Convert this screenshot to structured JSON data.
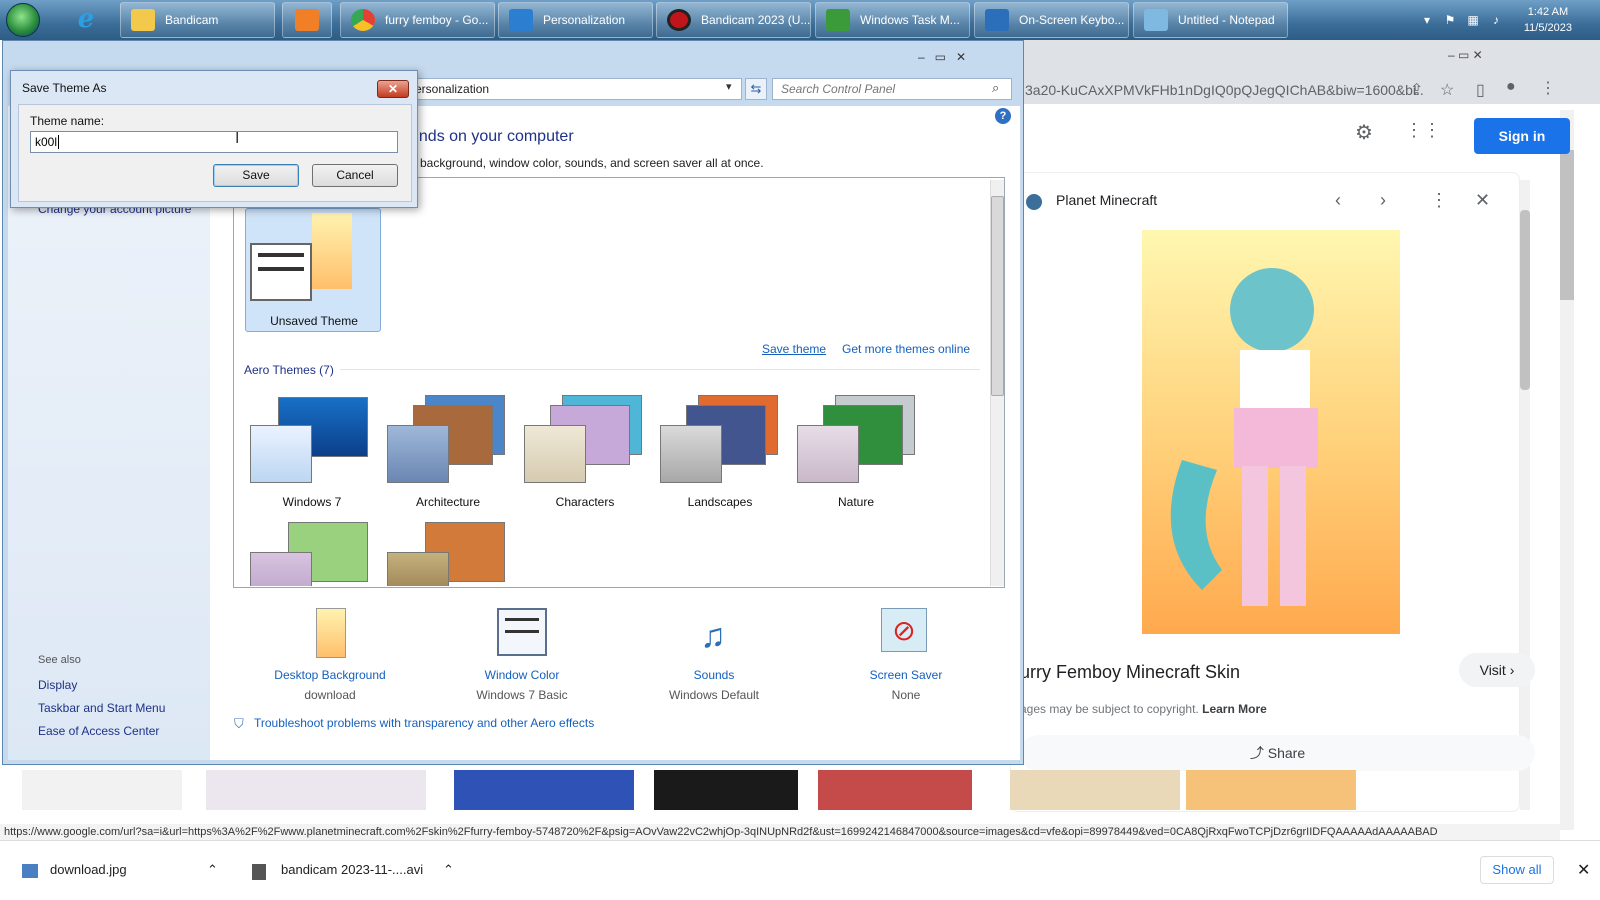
{
  "taskbar": {
    "buttons": [
      {
        "label": "Bandicam",
        "color": "#f3c94b"
      },
      {
        "label": "",
        "color": "#f07f27"
      },
      {
        "label": "furry femboy - Go...",
        "color": "#e44134"
      },
      {
        "label": "Personalization",
        "color": "#2c7fd0"
      },
      {
        "label": "Bandicam 2023 (U...",
        "color": "#c0161b"
      },
      {
        "label": "Windows Task M...",
        "color": "#3b9b3b"
      },
      {
        "label": "On-Screen Keybo...",
        "color": "#2b6fba"
      },
      {
        "label": "Untitled - Notepad",
        "color": "#7fb8e0"
      }
    ],
    "time": "1:42 AM",
    "date": "11/5/2023"
  },
  "chrome": {
    "omnibox_text": "3a20-KuCAxXPMVkFHb1nDgIQ0pQJegQIChAB&biw=1600&bi...",
    "signin_label": "Sign in",
    "panel_source": "Planet Minecraft",
    "result_title": "urry Femboy Minecraft Skin",
    "visit_label": "Visit",
    "copyright_text": "ages may be subject to copyright.",
    "learn_more": "Learn More",
    "share_label": "Share",
    "status_url": "https://www.google.com/url?sa=i&url=https%3A%2F%2Fwww.planetminecraft.com%2Fskin%2Ffurry-femboy-5748720%2F&psig=AOvVaw22vC2whjOp-3qINUpNRd2f&ust=1699242146847000&source=images&cd=vfe&opi=89978449&ved=0CA8QjRxqFwoTCPjDzr6grIIDFQAAAAAdAAAAABAD"
  },
  "downloads": {
    "items": [
      "download.jpg",
      "bandicam 2023-11-....avi"
    ],
    "show_all": "Show all"
  },
  "control_panel": {
    "address": "ersonalization",
    "search_placeholder": "Search Control Panel",
    "heading": "unds on your computer",
    "subheading": "p background, window color, sounds, and screen saver all at once.",
    "left_link_account": "Change your account picture",
    "unsaved_theme": "Unsaved Theme",
    "save_theme_link": "Save theme",
    "get_more_link": "Get more themes online",
    "aero_label": "Aero Themes (7)",
    "aero_themes": [
      "Windows 7",
      "Architecture",
      "Characters",
      "Landscapes",
      "Nature"
    ],
    "see_also": "See also",
    "see_also_links": [
      "Display",
      "Taskbar and Start Menu",
      "Ease of Access Center"
    ],
    "bottom_items": [
      {
        "title": "Desktop Background",
        "sub": "download"
      },
      {
        "title": "Window Color",
        "sub": "Windows 7 Basic"
      },
      {
        "title": "Sounds",
        "sub": "Windows Default"
      },
      {
        "title": "Screen Saver",
        "sub": "None"
      }
    ],
    "troubleshoot": "Troubleshoot problems with transparency and other Aero effects"
  },
  "dialog": {
    "title": "Save Theme As",
    "close_glyph": "✕",
    "label": "Theme name:",
    "value": "k00l",
    "save_label": "Save",
    "cancel_label": "Cancel"
  }
}
